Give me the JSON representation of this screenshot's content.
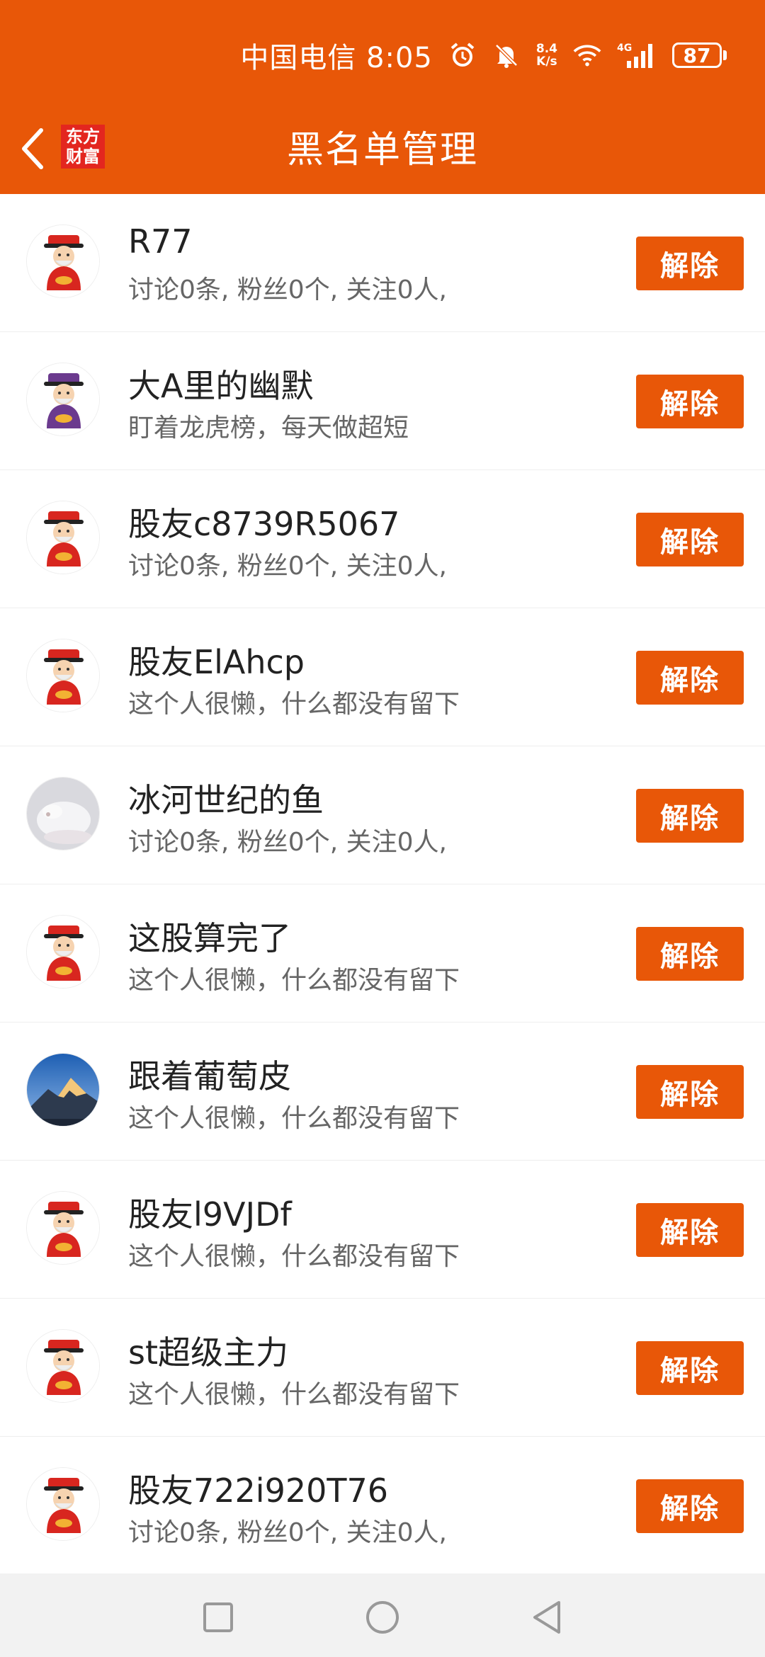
{
  "status_bar": {
    "carrier_time": "中国电信 8:05",
    "speed_value": "8.4",
    "speed_unit": "K/s",
    "network": "4G",
    "battery": "87",
    "icons": [
      "alarm-icon",
      "mute-bell-icon",
      "wifi-icon",
      "signal-icon",
      "battery-icon"
    ]
  },
  "app_bar": {
    "title": "黑名单管理",
    "logo_line1": "东方",
    "logo_line2": "财富",
    "back_icon": "chevron-left-icon"
  },
  "colors": {
    "accent": "#e85708",
    "logo_red": "#e3261f"
  },
  "button_label": "解除",
  "users": [
    {
      "name": "R77",
      "desc": "讨论0条, 粉丝0个, 关注0人,",
      "avatar": "fortune-god-avatar"
    },
    {
      "name": "大A里的幽默",
      "desc": "盯着龙虎榜，每天做超短",
      "avatar": "purple-fortune-god-avatar"
    },
    {
      "name": "股友c8739R5067",
      "desc": "讨论0条, 粉丝0个, 关注0人,",
      "avatar": "fortune-god-avatar"
    },
    {
      "name": "股友ElAhcp",
      "desc": "这个人很懒，什么都没有留下",
      "avatar": "fortune-god-avatar"
    },
    {
      "name": "冰河世纪的鱼",
      "desc": "讨论0条, 粉丝0个, 关注0人,",
      "avatar": "white-pet-photo-avatar"
    },
    {
      "name": "这股算完了",
      "desc": "这个人很懒，什么都没有留下",
      "avatar": "fortune-god-avatar"
    },
    {
      "name": "跟着葡萄皮",
      "desc": "这个人很懒，什么都没有留下",
      "avatar": "mountain-photo-avatar"
    },
    {
      "name": "股友l9VJDf",
      "desc": "这个人很懒，什么都没有留下",
      "avatar": "fortune-god-avatar"
    },
    {
      "name": "st超级主力",
      "desc": "这个人很懒，什么都没有留下",
      "avatar": "fortune-god-avatar"
    },
    {
      "name": "股友722i920T76",
      "desc": "讨论0条, 粉丝0个, 关注0人,",
      "avatar": "fortune-god-avatar"
    }
  ],
  "nav_bar": {
    "icons": [
      "recents-square-icon",
      "home-circle-icon",
      "back-triangle-icon"
    ]
  }
}
